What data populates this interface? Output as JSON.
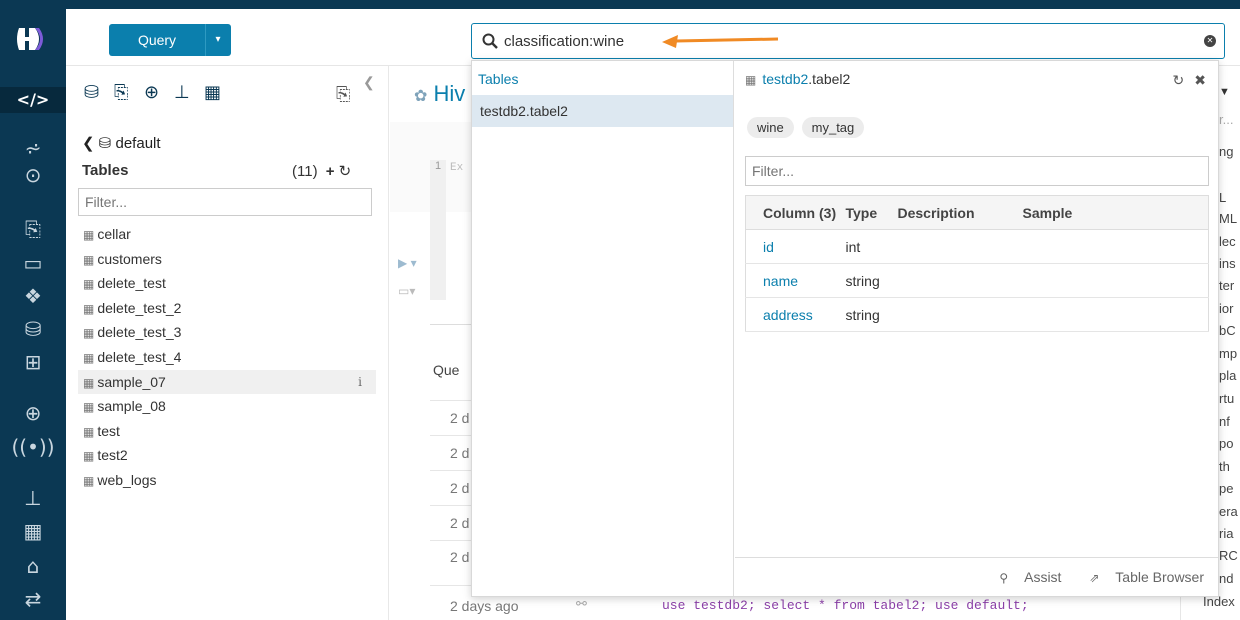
{
  "colors": {
    "rail": "#0b3853",
    "accent": "#0b7fad",
    "arrow": "#f08a24",
    "selected_row": "#dde8f1"
  },
  "toolbar": {
    "query_label": "Query",
    "query_caret": "▾"
  },
  "search": {
    "value": "classification:wine",
    "clear_icon": "close-circle-icon"
  },
  "rail": {
    "icons": [
      "hue-logo",
      "code-icon",
      "chart-icon",
      "circle-icon",
      "documents-icon",
      "folder-icon",
      "cubes-icon",
      "database-icon",
      "table-icon",
      "zoom-icon",
      "broadcast-icon",
      "sitemap-icon",
      "dashboard-icon",
      "lock-icon",
      "transfer-icon"
    ]
  },
  "assist": {
    "database": "default",
    "tables_header": "Tables",
    "tables_count": "(11)",
    "filter_placeholder": "Filter...",
    "tables": [
      "cellar",
      "customers",
      "delete_test",
      "delete_test_2",
      "delete_test_3",
      "delete_test_4",
      "sample_07",
      "sample_08",
      "test",
      "test2",
      "web_logs"
    ],
    "hovered_table": "sample_07"
  },
  "editor": {
    "tab_label": "Hiv",
    "line_number": "1",
    "placeholder_fragment": "Ex",
    "history_header": "Que",
    "history_dates": [
      "2 d",
      "2 d",
      "2 d",
      "2 d",
      "2 d"
    ],
    "last_history_date": "2 days ago",
    "last_history_code": "use testdb2; select * from tabel2; use default;"
  },
  "right_strip": {
    "fragments": [
      "r...",
      "ng",
      "L",
      "ML",
      "lec",
      "ins",
      "ter",
      "ior",
      "bC",
      "mp",
      "pla",
      "rtu",
      "nf",
      "po",
      "th",
      "pe",
      "era",
      "ria",
      "RC",
      "nd",
      "Index"
    ]
  },
  "results": {
    "category": "Tables",
    "items": [
      "testdb2.tabel2"
    ],
    "detail": {
      "db": "testdb2",
      "table": ".tabel2",
      "tags": [
        "wine",
        "my_tag"
      ],
      "filter_placeholder": "Filter...",
      "columns_header": [
        "Column (3)",
        "Type",
        "Description",
        "Sample"
      ],
      "columns": [
        {
          "name": "id",
          "type": "int"
        },
        {
          "name": "name",
          "type": "string"
        },
        {
          "name": "address",
          "type": "string"
        }
      ],
      "footer_assist": "Assist",
      "footer_browser": "Table Browser"
    }
  }
}
